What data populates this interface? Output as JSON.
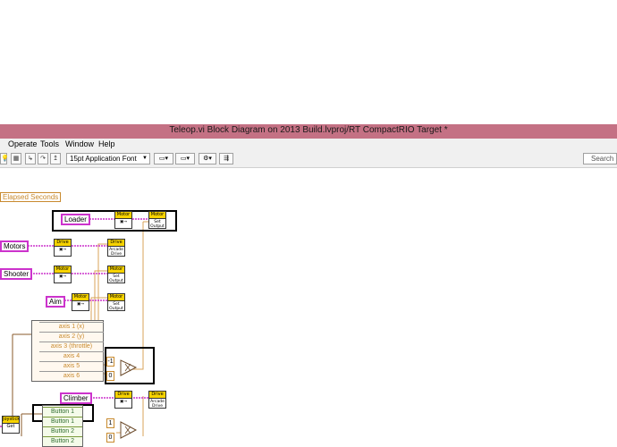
{
  "window": {
    "title": "Teleop.vi Block Diagram on 2013 Build.lvproj/RT CompactRIO Target *"
  },
  "menu": {
    "items": [
      "Operate",
      "Tools",
      "Window",
      "Help"
    ]
  },
  "toolbar": {
    "font_select": "15pt Application Font",
    "search_placeholder": "Search",
    "buttons": [
      "run-icon",
      "stop-icon",
      "pause-icon",
      "step-into-icon",
      "step-over-icon",
      "step-out-icon",
      "highlight-icon",
      "retain-wire-icon",
      "clean-up-icon"
    ]
  },
  "diagram": {
    "elapsed_label": "Elapsed Seconds",
    "controls": {
      "loader": "Loader",
      "motors": "Motors",
      "shooter": "Shooter",
      "aim": "Aim",
      "climber": "Climber"
    },
    "subvi": {
      "motor": "Motor",
      "drive": "Drive",
      "set_output": "Set Output",
      "arcade_drive": "Arcade Drive",
      "joystick": "Joystick",
      "get": "Get"
    },
    "axes": [
      "axis 1 (x)",
      "axis 2 (y)",
      "axis 3 (throttle)",
      "axis 4",
      "axis 5",
      "axis 6"
    ],
    "buttons": [
      "Button 1",
      "Button 1",
      "Button 2",
      "Button 2"
    ],
    "constants": {
      "neg_one": "-1",
      "zero": "0",
      "one": "1",
      "zero2": "0"
    }
  }
}
